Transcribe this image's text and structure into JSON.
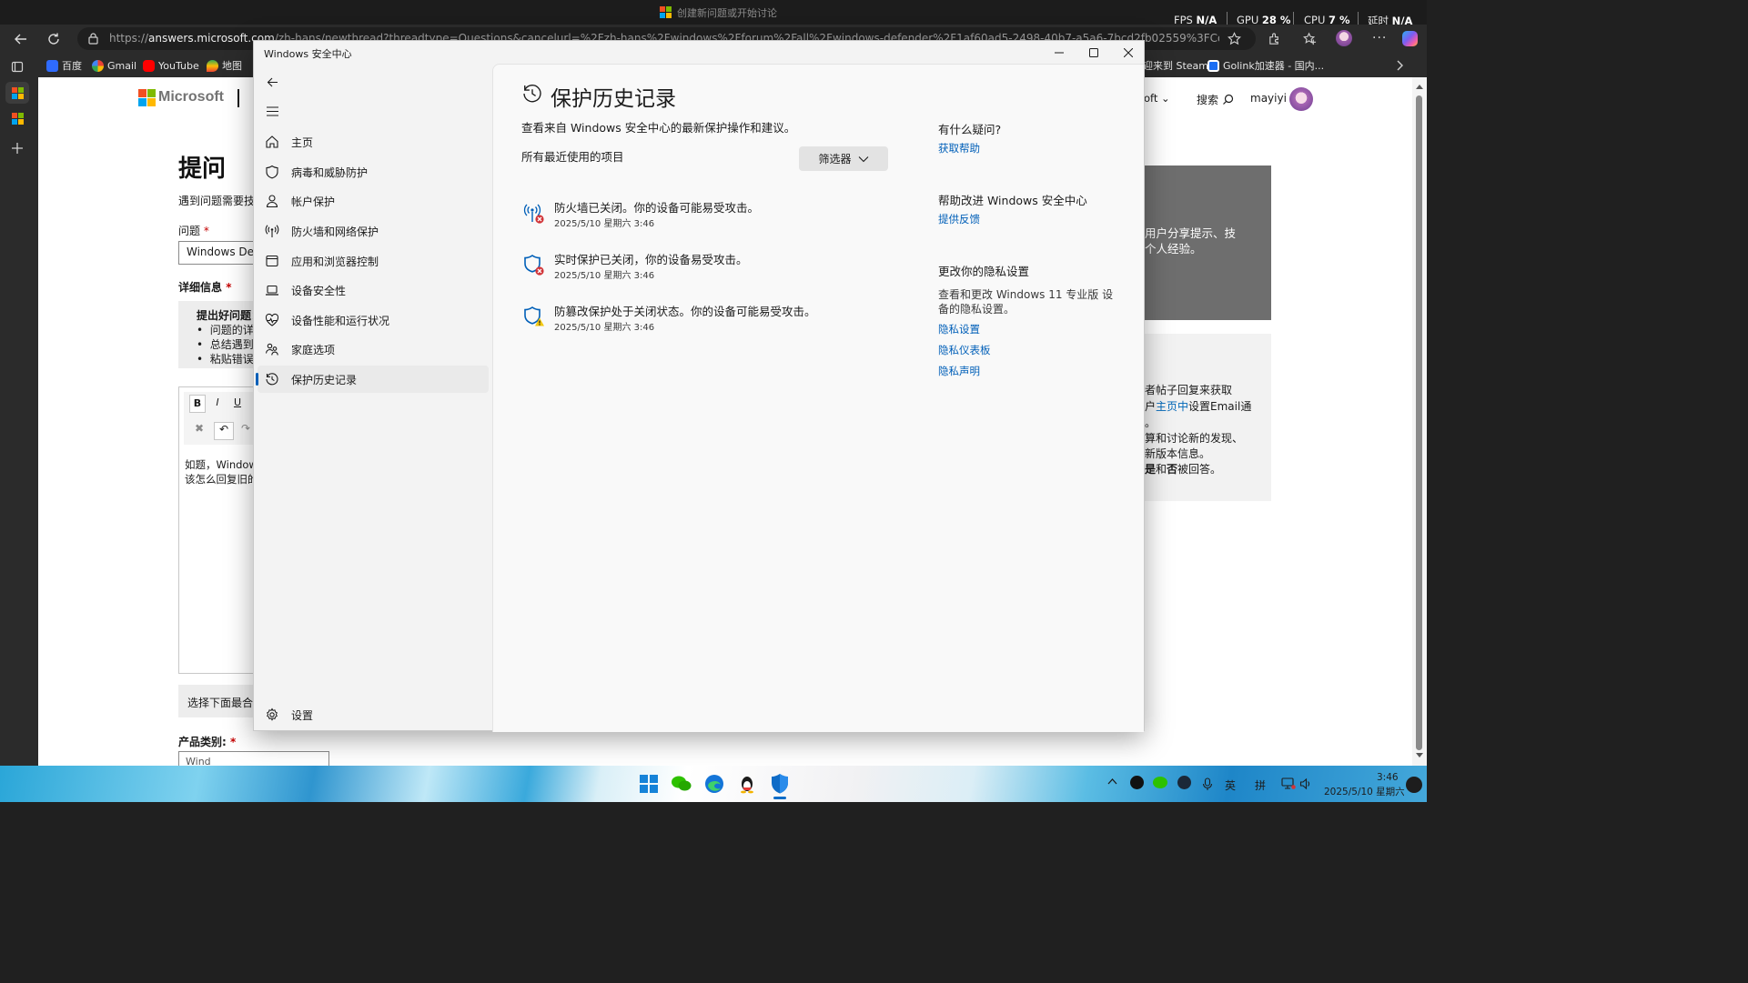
{
  "browser": {
    "window_title": "创建新问题或开始讨论",
    "perf": {
      "fps_label": "FPS",
      "fps_value": "N/A",
      "gpu_label": "GPU",
      "gpu_value": "28 %",
      "cpu_label": "CPU",
      "cpu_value": "7 %",
      "latency_label": "延时",
      "latency_value": "N/A"
    },
    "url_scheme": "https://",
    "url_host": "answers.microsoft.com",
    "url_rest": "/zh-hans/newthread?threadtype=Questions&cancelurl=%2Fzh-hans%2Fwindows%2Fforum%2Fall%2Fwindows-defender%2F1af60ad5-2498-40b7-a5a6-7bcd2fb02559%3FCorrelationId%3DCatHelpBCOP%26Correlatio...",
    "bookmarks": [
      "百度",
      "Gmail",
      "YouTube",
      "地图",
      "迎来到 Steam",
      "Golink加速器 - 国内..."
    ]
  },
  "webpage": {
    "brand": "Microsoft",
    "nav_partial": "oft",
    "search_label": "搜索",
    "user_name": "mayiyi",
    "page_heading": "提问",
    "intro_partial": "遇到问题需要技",
    "question_label": "问题",
    "question_value_partial": "Windows Defe",
    "details_label": "详细信息",
    "tips_title_partial": "提出好问题：",
    "tips": [
      "问题的详",
      "总结遇到",
      "粘贴错误"
    ],
    "editor_body_line1": "如题，Window",
    "editor_body_line2": "该怎么回复旧的",
    "choose_partial": "选择下面最合",
    "category_label": "产品类别:",
    "category_value_partial": "Wind",
    "required_mark": "*",
    "promo_line1": "用户分享提示、技",
    "promo_line2": "个人经验。",
    "info_line1": "者帖子回复来获取",
    "info_line2_pre": "户",
    "info_line2_link": "主页中",
    "info_line2_post": "设置Email通",
    "info_line3": "。",
    "info_line4": "算和讨论新的发现、",
    "info_line5": "新版本信息。",
    "info_line6_pre": "是",
    "info_line6_mid": "和",
    "info_line6_bold": "否",
    "info_line6_post": "被回答。"
  },
  "security": {
    "window_title": "Windows 安全中心",
    "nav": [
      {
        "label": "主页",
        "icon": "home-icon"
      },
      {
        "label": "病毒和威胁防护",
        "icon": "shield-icon"
      },
      {
        "label": "帐户保护",
        "icon": "person-icon"
      },
      {
        "label": "防火墙和网络保护",
        "icon": "antenna-icon"
      },
      {
        "label": "应用和浏览器控制",
        "icon": "app-window-icon"
      },
      {
        "label": "设备安全性",
        "icon": "laptop-icon"
      },
      {
        "label": "设备性能和运行状况",
        "icon": "heart-pulse-icon"
      },
      {
        "label": "家庭选项",
        "icon": "family-icon"
      },
      {
        "label": "保护历史记录",
        "icon": "history-icon"
      }
    ],
    "settings_label": "设置",
    "page_title": "保护历史记录",
    "page_subtitle": "查看来自 Windows 安全中心的最新保护操作和建议。",
    "recent_label": "所有最近使用的项目",
    "filter_label": "筛选器",
    "history": [
      {
        "text": "防火墙已关闭。你的设备可能易受攻击。",
        "date": "2025/5/10 星期六 3:46",
        "icon": "firewall-alert-icon",
        "badge": "error"
      },
      {
        "text": "实时保护已关闭，你的设备易受攻击。",
        "date": "2025/5/10 星期六 3:46",
        "icon": "shield-error-icon",
        "badge": "error"
      },
      {
        "text": "防篡改保护处于关闭状态。你的设备可能易受攻击。",
        "date": "2025/5/10 星期六 3:46",
        "icon": "shield-warning-icon",
        "badge": "warning"
      }
    ],
    "side": {
      "q_heading": "有什么疑问?",
      "get_help": "获取帮助",
      "improve_heading": "帮助改进 Windows 安全中心",
      "feedback": "提供反馈",
      "privacy_heading": "更改你的隐私设置",
      "privacy_desc_1": "查看和更改 Windows 11 专业版 设",
      "privacy_desc_2": "备的隐私设置。",
      "privacy_settings": "隐私设置",
      "privacy_dashboard": "隐私仪表板",
      "privacy_statement": "隐私声明"
    }
  },
  "taskbar": {
    "ime_lang": "英",
    "ime_mode": "拼",
    "time": "3:46",
    "date": "2025/5/10 星期六"
  },
  "colors": {
    "accent": "#005fb8",
    "error_red": "#d13438",
    "warning_yellow": "#f2c811",
    "ms_red": "#f25022",
    "ms_green": "#7fba00",
    "ms_blue": "#00a4ef",
    "ms_yellow": "#ffb900"
  }
}
